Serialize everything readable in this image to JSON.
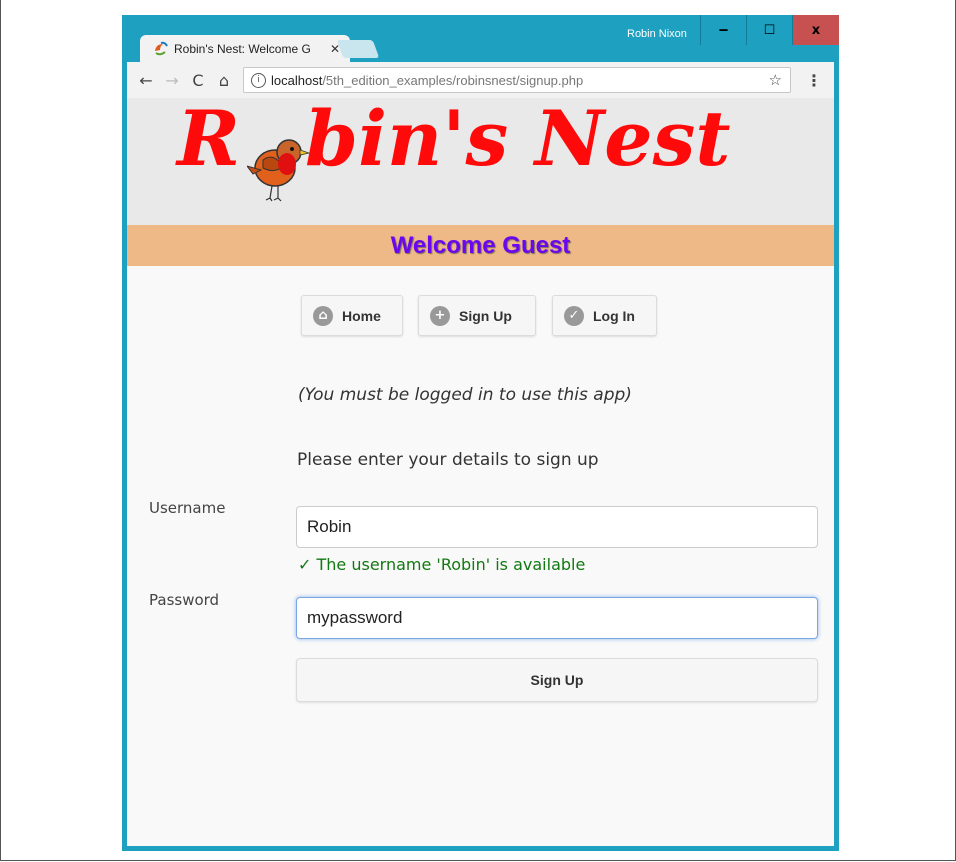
{
  "browser": {
    "tab_title": "Robin's Nest: Welcome G",
    "tab_close": "✕",
    "user_name": "Robin Nixon",
    "window_controls": {
      "minimize": "‒",
      "maximize": "☐",
      "close": "x"
    },
    "url_host": "localhost",
    "url_path": "/5th_edition_examples/robinsnest/signup.php",
    "nav_icons": {
      "back": "←",
      "forward": "→",
      "reload": "C",
      "home": "⌂",
      "info": "i",
      "star": "☆",
      "menu": "⋮"
    }
  },
  "header": {
    "logo_first": "R",
    "logo_rest": "bin's Nest",
    "welcome": "Welcome Guest"
  },
  "nav": {
    "home": {
      "label": "Home",
      "icon": "home-icon"
    },
    "signup": {
      "label": "Sign Up",
      "icon": "plus-icon"
    },
    "login": {
      "label": "Log In",
      "icon": "check-icon"
    }
  },
  "main": {
    "notice": "(You must be logged in to use this app)",
    "prompt": "Please enter your details to sign up"
  },
  "form": {
    "username_label": "Username",
    "username_value": "Robin",
    "availability": "✓ The username 'Robin' is available",
    "password_label": "Password",
    "password_value": "mypassword",
    "submit_label": "Sign Up"
  },
  "colors": {
    "window_frame": "#1ea1c1",
    "logo_red": "#ff0a0a",
    "welcome_band": "#efb987",
    "welcome_text": "#6b06f0",
    "available_green": "#127812"
  }
}
